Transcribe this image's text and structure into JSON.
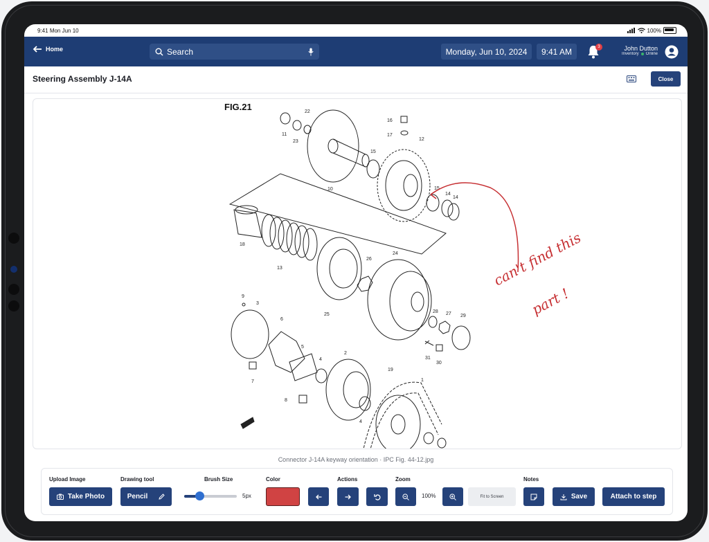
{
  "status": {
    "time": "9:41",
    "date": "Mon Jun 10",
    "battery": "100%"
  },
  "nav": {
    "home_label": "Home",
    "search_placeholder": "Search",
    "date": "Monday, Jun 10, 2024",
    "time": "9:41 AM",
    "notification_count": "3",
    "user_name": "John Dutton",
    "user_role": "Inventory",
    "user_status": "Online"
  },
  "page": {
    "title": "Steering Assembly J-14A",
    "close_label": "Close"
  },
  "drawing": {
    "fig_label": "FIG.21",
    "part_numbers": [
      "11",
      "22",
      "23",
      "10",
      "16",
      "17",
      "12",
      "15",
      "15",
      "14",
      "14",
      "18",
      "13",
      "26",
      "24",
      "25",
      "9",
      "3",
      "6",
      "5",
      "4",
      "2",
      "28",
      "27",
      "29",
      "31",
      "30",
      "7",
      "8",
      "19",
      "1",
      "4"
    ],
    "annotation": [
      "can't find this",
      "part !"
    ]
  },
  "caption": "Connector J-14A keyway orientation · IPC Fig. 44-12.jpg",
  "toolbar": {
    "upload_label": "Upload Image",
    "take_photo": "Take Photo",
    "drawing_tool_label": "Drawing tool",
    "pencil": "Pencil",
    "brush_size_label": "Brush Size",
    "brush_size_value": "5px",
    "brush_size_fraction": 0.29,
    "color_label": "Color",
    "color_value": "#d04343",
    "actions_label": "Actions",
    "zoom_label": "Zoom",
    "zoom_value": "100%",
    "fit_to_screen": "Fit to Screen",
    "notes_label": "Notes",
    "save": "Save",
    "attach": "Attach to step"
  },
  "icons": [
    "camera-icon",
    "pencil-icon",
    "arrow-left-icon",
    "arrow-right-icon",
    "undo-icon",
    "zoom-out-icon",
    "zoom-in-icon",
    "note-icon",
    "download-icon",
    "search-icon",
    "mic-icon",
    "bell-icon",
    "user-icon",
    "keyboard-icon",
    "back-arrow-icon"
  ]
}
